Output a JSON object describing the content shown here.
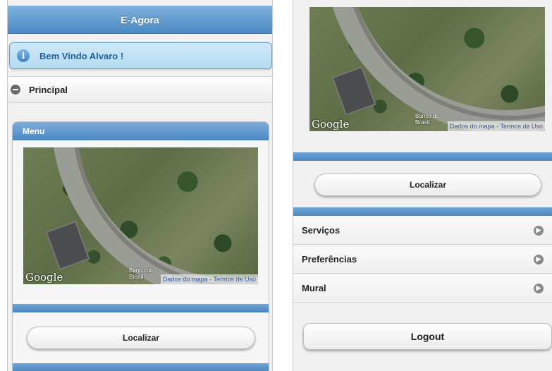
{
  "left": {
    "header_title": "E-Agora",
    "welcome_text": "Bem Vindo Alvaro !",
    "collapsible_title": "Principal",
    "card_title": "Menu",
    "map": {
      "google": "Google",
      "banco": "Banco do Brasil",
      "dados": "Dados do mapa",
      "termos": "Termos de Uso"
    },
    "locate_button": "Localizar"
  },
  "right": {
    "map": {
      "google": "Google",
      "banco": "Banco do Brasil",
      "dados": "Dados do mapa",
      "termos": "Termos de Uso"
    },
    "locate_button": "Localizar",
    "menu_items": [
      {
        "label": "Serviços"
      },
      {
        "label": "Preferências"
      },
      {
        "label": "Mural"
      }
    ],
    "logout_button": "Logout"
  }
}
